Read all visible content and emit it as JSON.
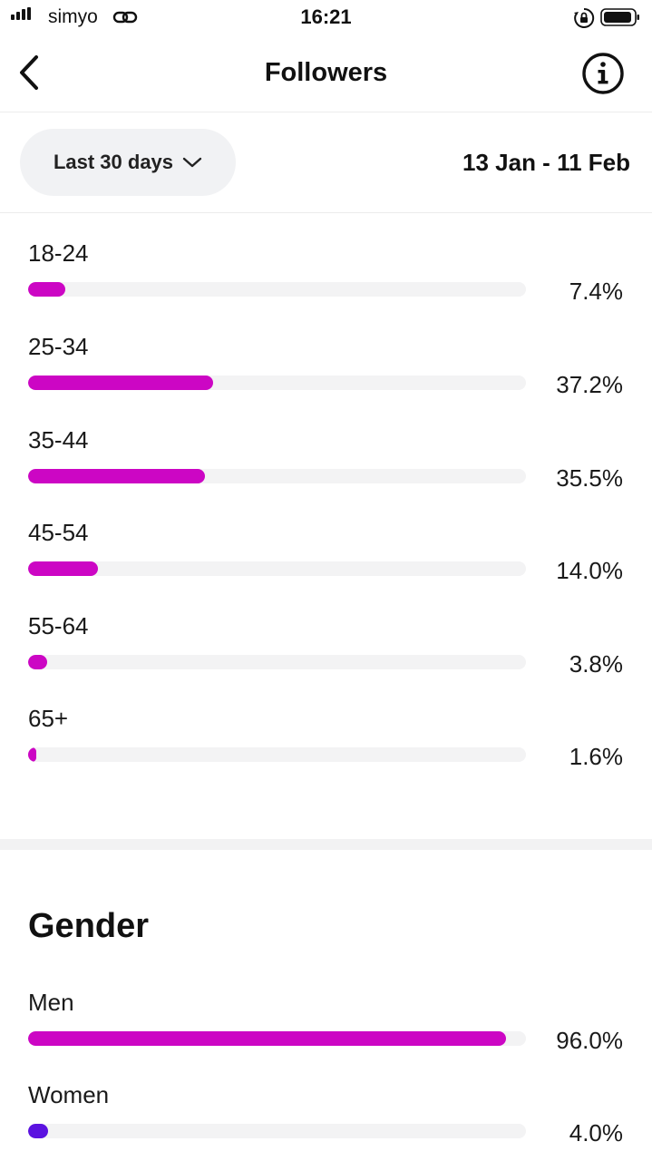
{
  "status_bar": {
    "carrier": "simyo",
    "time": "16:21",
    "icons": [
      "signal-icon",
      "link-icon",
      "orientation-lock-icon",
      "battery-icon"
    ]
  },
  "header": {
    "title": "Followers",
    "back_icon": "chevron-left-icon",
    "info_icon": "info-icon"
  },
  "filter": {
    "period_label": "Last 30 days",
    "date_range": "13 Jan - 11 Feb"
  },
  "colors": {
    "magenta": "#cc06c4",
    "violet": "#5b12e0",
    "track": "#f3f3f4"
  },
  "age": {
    "rows": [
      {
        "label": "18-24",
        "value": "7.4%",
        "percent": 7.4
      },
      {
        "label": "25-34",
        "value": "37.2%",
        "percent": 37.2
      },
      {
        "label": "35-44",
        "value": "35.5%",
        "percent": 35.5
      },
      {
        "label": "45-54",
        "value": "14.0%",
        "percent": 14.0
      },
      {
        "label": "55-64",
        "value": "3.8%",
        "percent": 3.8
      },
      {
        "label": "65+",
        "value": "1.6%",
        "percent": 1.6
      }
    ]
  },
  "gender": {
    "title": "Gender",
    "rows": [
      {
        "label": "Men",
        "value": "96.0%",
        "percent": 96.0,
        "color": "#cc06c4"
      },
      {
        "label": "Women",
        "value": "4.0%",
        "percent": 4.0,
        "color": "#5b12e0"
      }
    ]
  }
}
